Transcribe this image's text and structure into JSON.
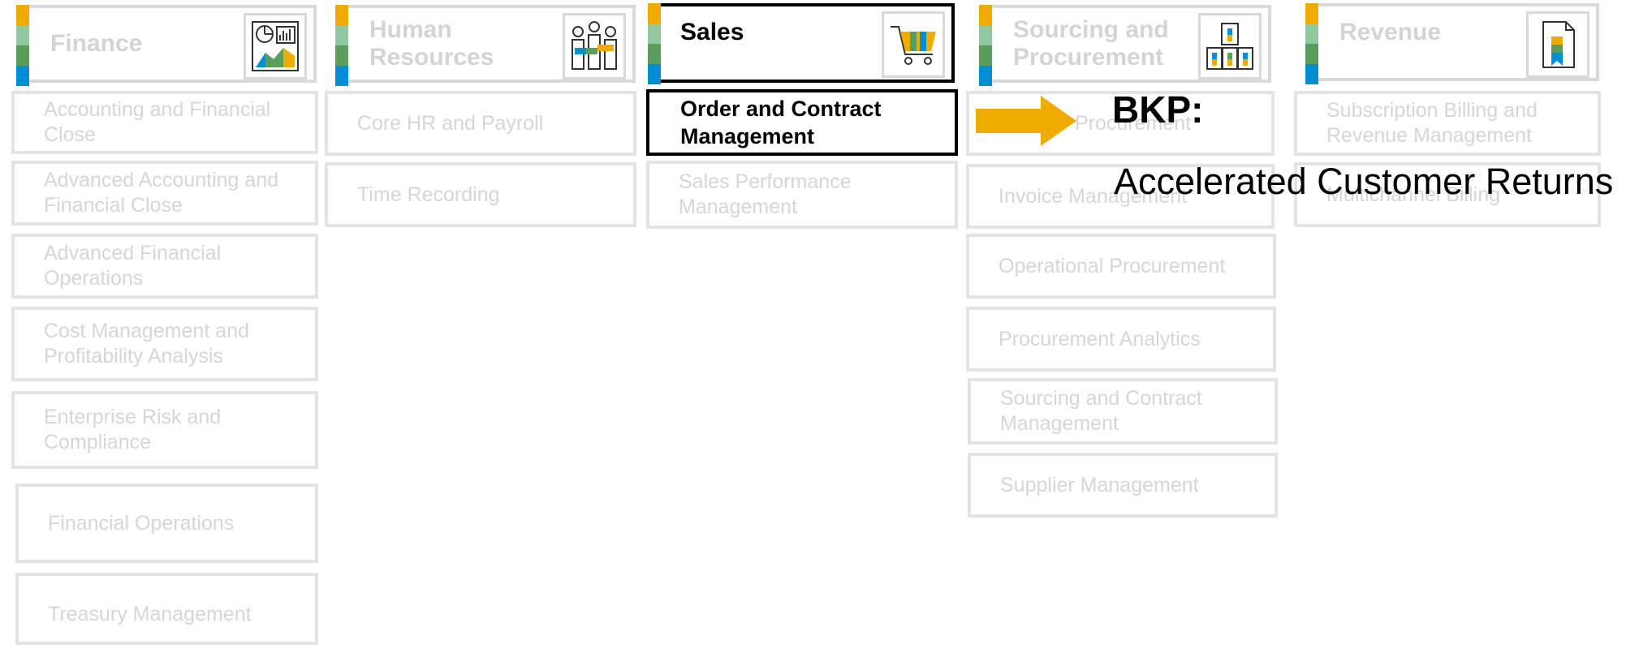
{
  "colors": {
    "stripe": [
      "#f0ab00",
      "#91c8a0",
      "#5b9e5b",
      "#008fd3"
    ],
    "inactive_text": "#d4d4d4",
    "active_border": "#000000",
    "arrow": "#f0ab00"
  },
  "columns": [
    {
      "title": "Finance",
      "icon": "analytics-chart-icon",
      "active": false,
      "items": [
        "Accounting and Financial\nClose",
        "Advanced Accounting and\nFinancial Close",
        "Advanced Financial\nOperations",
        "Cost Management and\nProfitability Analysis",
        "Enterprise Risk and\nCompliance",
        "Financial Operations",
        "Treasury  Management"
      ]
    },
    {
      "title": "Human\nResources",
      "icon": "people-icon",
      "active": false,
      "items": [
        "Core HR and Payroll",
        "Time Recording"
      ]
    },
    {
      "title": "Sales",
      "icon": "shopping-cart-icon",
      "active": true,
      "items": [
        "Order and Contract\nManagement",
        "Sales Performance\nManagement"
      ]
    },
    {
      "title": "Sourcing and\nProcurement",
      "icon": "boxes-icon",
      "active": false,
      "items": [
        "Procurement",
        "Invoice Management",
        "Operational Procurement",
        "Procurement Analytics",
        "Sourcing and Contract\nManagement",
        "Supplier Management"
      ]
    },
    {
      "title": "Revenue",
      "icon": "document-ribbon-icon",
      "active": false,
      "items": [
        "Subscription Billing and\nRevenue Management",
        "Multichannel Billing"
      ]
    }
  ],
  "callout": {
    "title": "BKP:",
    "subtitle": "Accelerated Customer Returns"
  }
}
